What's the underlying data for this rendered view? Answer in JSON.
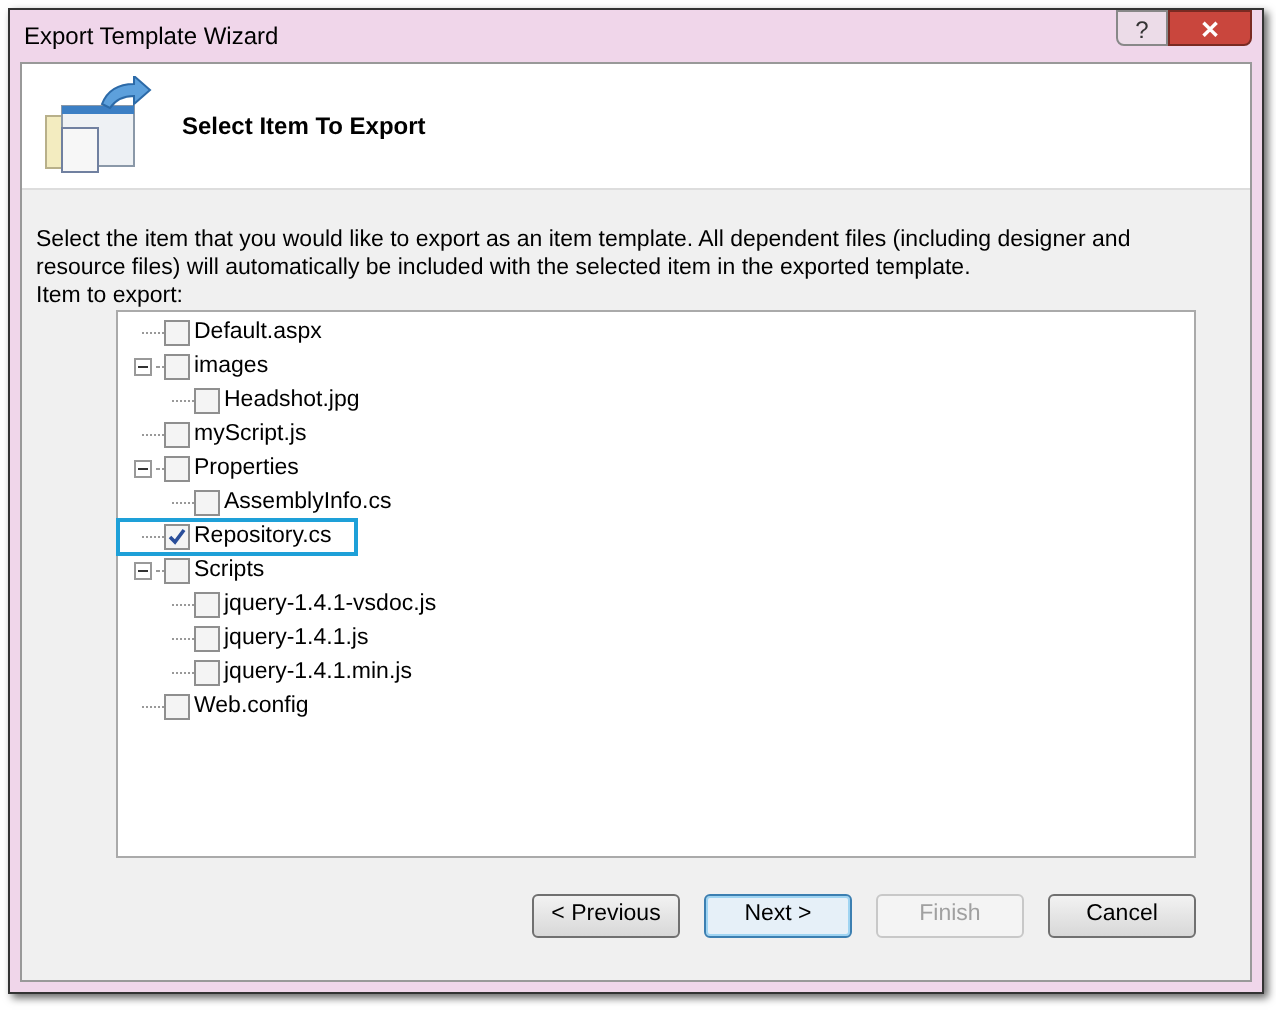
{
  "window": {
    "title": "Export Template Wizard",
    "help_label": "?",
    "close_label": "✕"
  },
  "header": {
    "title": "Select Item To Export"
  },
  "description": "Select the item that you would like to export as an item template. All dependent files (including designer and resource files) will automatically be included with the selected item in the exported template.",
  "tree_label": "Item to export:",
  "tree": [
    {
      "label": "Default.aspx",
      "checked": false
    },
    {
      "label": "images",
      "checked": false,
      "expanded": true,
      "children": [
        {
          "label": "Headshot.jpg",
          "checked": false
        }
      ]
    },
    {
      "label": "myScript.js",
      "checked": false
    },
    {
      "label": "Properties",
      "checked": false,
      "expanded": true,
      "children": [
        {
          "label": "AssemblyInfo.cs",
          "checked": false
        }
      ]
    },
    {
      "label": "Repository.cs",
      "checked": true,
      "highlighted": true
    },
    {
      "label": "Scripts",
      "checked": false,
      "expanded": true,
      "children": [
        {
          "label": "jquery-1.4.1-vsdoc.js",
          "checked": false
        },
        {
          "label": "jquery-1.4.1.js",
          "checked": false
        },
        {
          "label": "jquery-1.4.1.min.js",
          "checked": false
        }
      ]
    },
    {
      "label": "Web.config",
      "checked": false
    }
  ],
  "buttons": [
    {
      "label": "< Previous",
      "disabled": false,
      "default": false
    },
    {
      "label": "Next >",
      "disabled": false,
      "default": true
    },
    {
      "label": "Finish",
      "disabled": true,
      "default": false
    },
    {
      "label": "Cancel",
      "disabled": false,
      "default": false
    }
  ]
}
